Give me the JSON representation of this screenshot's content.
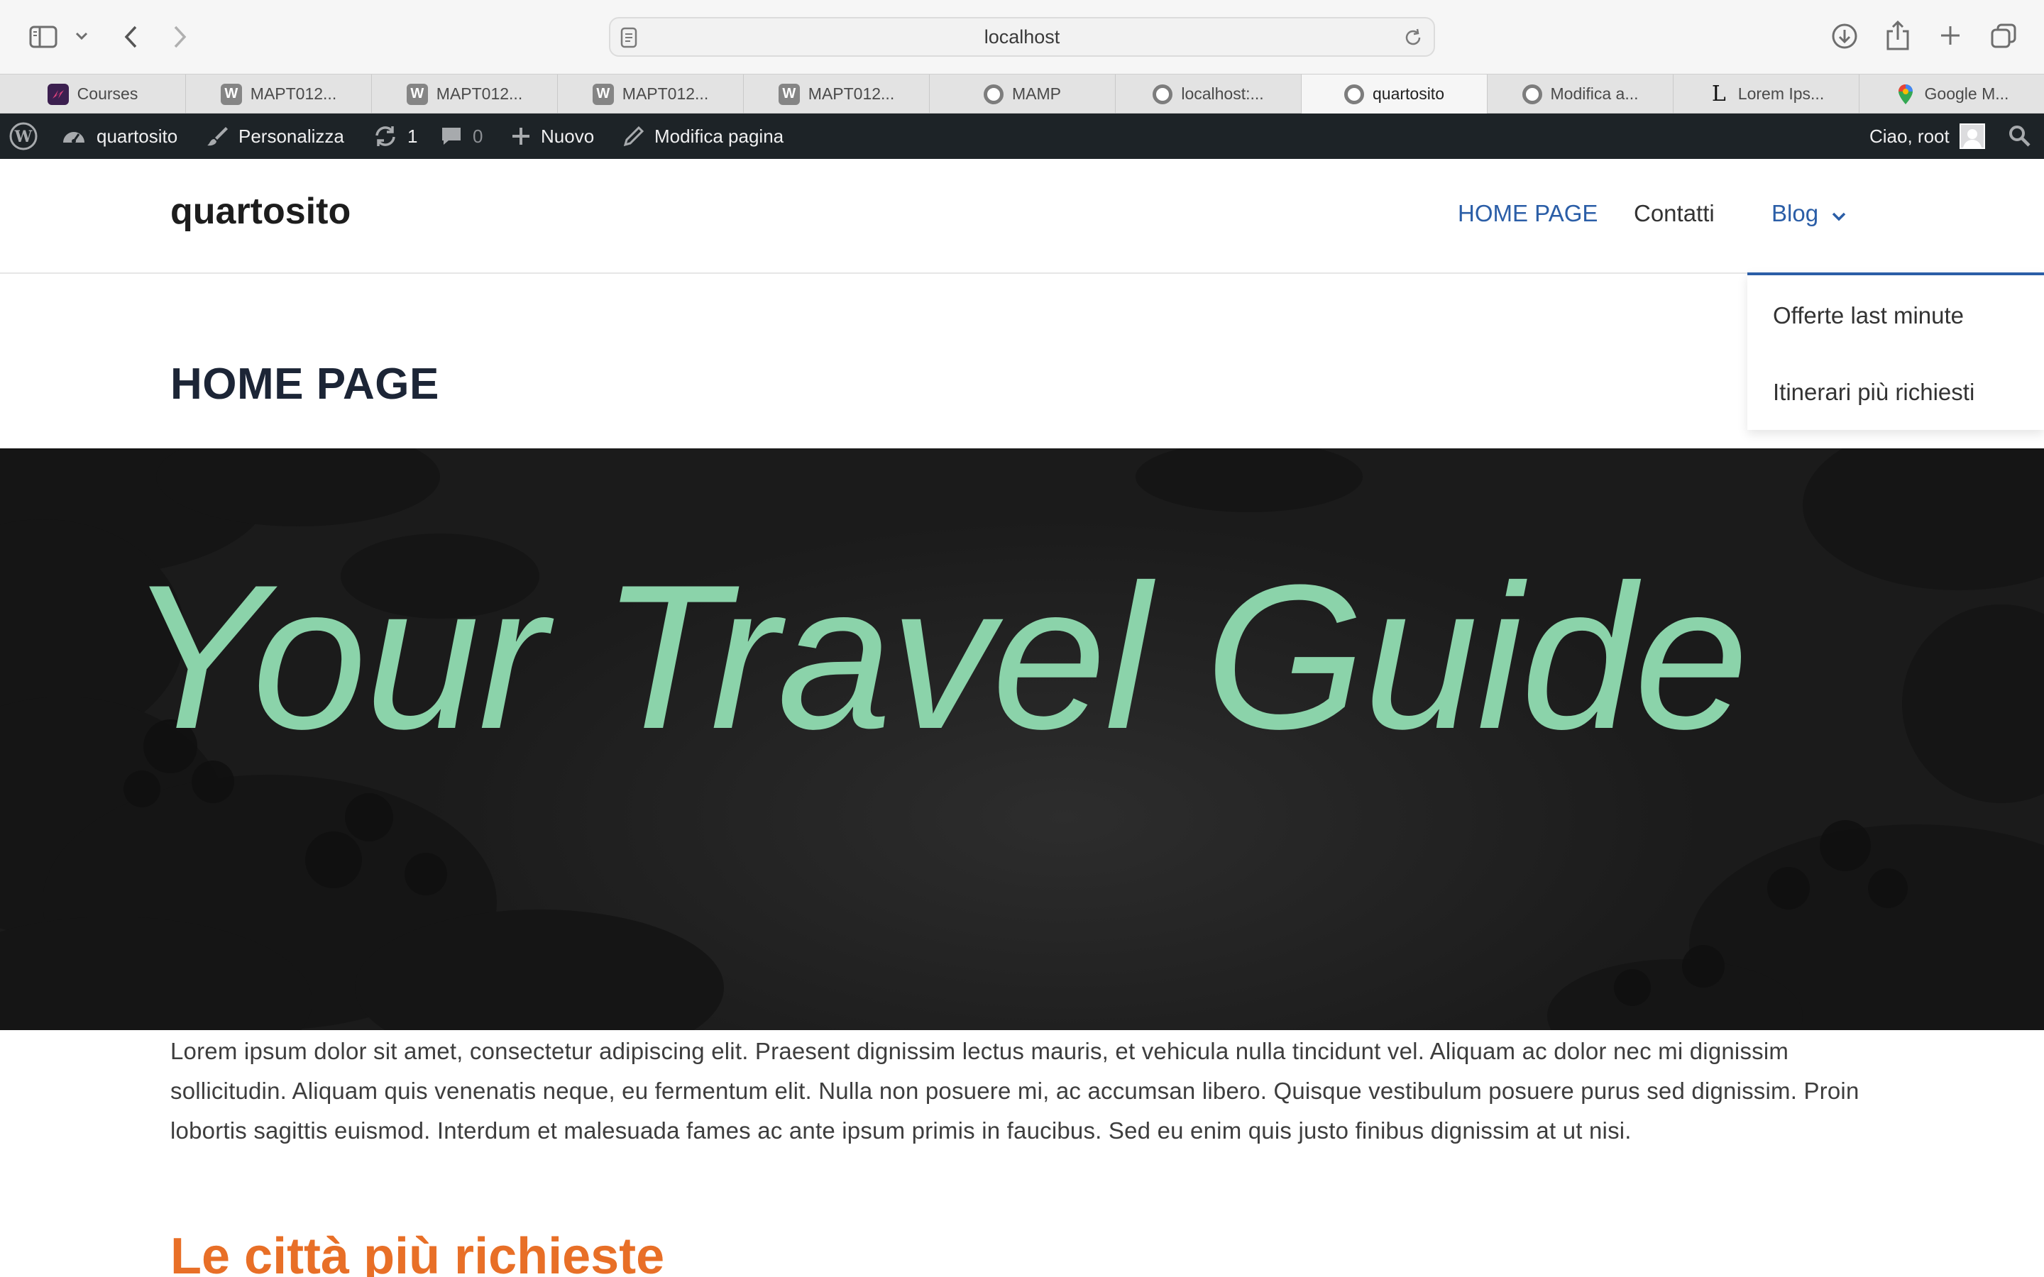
{
  "browser": {
    "url": "localhost",
    "tabs": [
      {
        "label": "Courses",
        "favicon": "courses-icon"
      },
      {
        "label": "MAPT012...",
        "favicon": "wordpress-w-icon"
      },
      {
        "label": "MAPT012...",
        "favicon": "wordpress-w-icon"
      },
      {
        "label": "MAPT012...",
        "favicon": "wordpress-w-icon"
      },
      {
        "label": "MAPT012...",
        "favicon": "wordpress-w-icon"
      },
      {
        "label": "MAMP",
        "favicon": "mamp-icon"
      },
      {
        "label": "localhost:...",
        "favicon": "mamp-icon"
      },
      {
        "label": "quartosito",
        "favicon": "mamp-icon",
        "active": true
      },
      {
        "label": "Modifica a...",
        "favicon": "mamp-icon"
      },
      {
        "label": "Lorem Ips...",
        "favicon": "lorem-ipsum-icon"
      },
      {
        "label": "Google M...",
        "favicon": "google-maps-icon"
      }
    ]
  },
  "adminbar": {
    "site_name": "quartosito",
    "customize": "Personalizza",
    "updates_count": "1",
    "comments_count": "0",
    "new": "Nuovo",
    "edit_page": "Modifica pagina",
    "greeting": "Ciao, root"
  },
  "site": {
    "title": "quartosito",
    "nav": {
      "home": "HOME PAGE",
      "contacts": "Contatti",
      "blog": "Blog"
    },
    "dropdown": [
      "Offerte last minute",
      "Itinerari più richiesti"
    ]
  },
  "page": {
    "title": "HOME PAGE",
    "hero_title": "Your Travel Guide",
    "body_text": "Lorem ipsum dolor sit amet, consectetur adipiscing elit. Praesent dignissim lectus mauris, et vehicula nulla tincidunt vel. Aliquam ac dolor nec mi dignissim sollicitudin. Aliquam quis venenatis neque, eu fermentum elit. Nulla non posuere mi, ac accumsan libero. Quisque vestibulum posuere purus sed dignissim. Proin lobortis sagittis euismod. Interdum et malesuada fames ac ante ipsum primis in faucibus. Sed eu enim quis justo finibus dignissim at ut nisi.",
    "section_heading": "Le città più richieste"
  },
  "colors": {
    "hero_text": "#8bd3aa",
    "link_blue": "#2b5ea7",
    "heading_orange": "#e86f27",
    "adminbar_bg": "#1d2327"
  }
}
